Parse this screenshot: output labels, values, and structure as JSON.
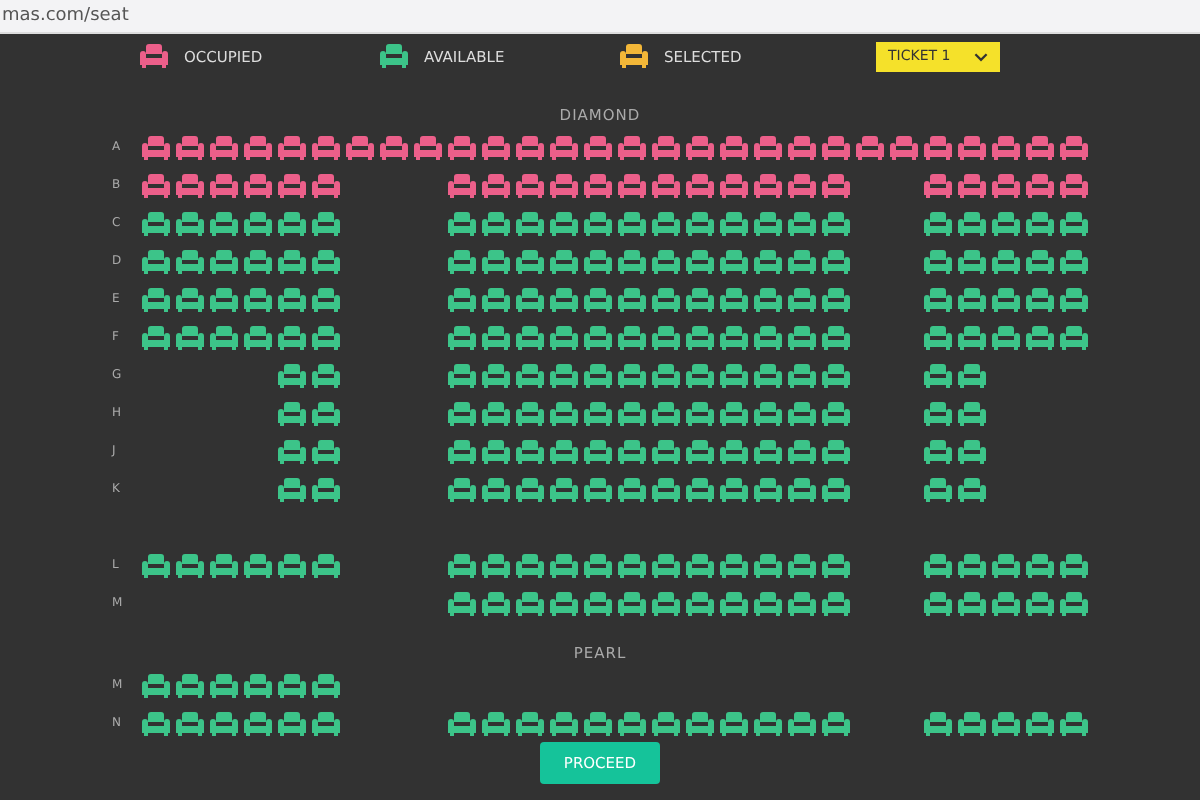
{
  "address_bar": {
    "url": "mas.com/seat"
  },
  "legend": [
    {
      "label": "OCCUPIED",
      "color": "#ec5f8a"
    },
    {
      "label": "AVAILABLE",
      "color": "#3cc489"
    },
    {
      "label": "SELECTED",
      "color": "#f3b738"
    }
  ],
  "ticket_select": {
    "value": "TICKET 1"
  },
  "sections": [
    {
      "title": "DIAMOND",
      "rows": [
        {
          "label": "A",
          "kind": "row",
          "seats": [
            {
              "kind": "seat",
              "occupied": true
            },
            {
              "kind": "seat",
              "occupied": true
            },
            {
              "kind": "seat",
              "occupied": true
            },
            {
              "kind": "seat",
              "occupied": true
            },
            {
              "kind": "seat",
              "occupied": true
            },
            {
              "kind": "seat",
              "occupied": true
            },
            {
              "kind": "seat",
              "occupied": true
            },
            {
              "kind": "seat",
              "occupied": true
            },
            {
              "kind": "seat",
              "occupied": true
            },
            {
              "kind": "seat",
              "occupied": true
            },
            {
              "kind": "seat",
              "occupied": true
            },
            {
              "kind": "seat",
              "occupied": true
            },
            {
              "kind": "seat",
              "occupied": true
            },
            {
              "kind": "seat",
              "occupied": true
            },
            {
              "kind": "seat",
              "occupied": true
            },
            {
              "kind": "seat",
              "occupied": true
            },
            {
              "kind": "seat",
              "occupied": true
            },
            {
              "kind": "seat",
              "occupied": true
            },
            {
              "kind": "seat",
              "occupied": true
            },
            {
              "kind": "seat",
              "occupied": true
            },
            {
              "kind": "seat",
              "occupied": true
            },
            {
              "kind": "seat",
              "occupied": true
            },
            {
              "kind": "seat",
              "occupied": true
            },
            {
              "kind": "seat",
              "occupied": true
            },
            {
              "kind": "seat",
              "occupied": true
            },
            {
              "kind": "seat",
              "occupied": true
            },
            {
              "kind": "seat",
              "occupied": true
            },
            {
              "kind": "seat",
              "occupied": true
            }
          ]
        },
        {
          "label": "B",
          "kind": "row",
          "seats": [
            {
              "kind": "seat",
              "occupied": true
            },
            {
              "kind": "seat",
              "occupied": true
            },
            {
              "kind": "seat",
              "occupied": true
            },
            {
              "kind": "seat",
              "occupied": true
            },
            {
              "kind": "seat",
              "occupied": true
            },
            {
              "kind": "seat",
              "occupied": true
            },
            {
              "kind": "aisle"
            },
            {
              "kind": "aisle"
            },
            {
              "kind": "aisle"
            },
            {
              "kind": "seat",
              "occupied": true
            },
            {
              "kind": "seat",
              "occupied": true
            },
            {
              "kind": "seat",
              "occupied": true
            },
            {
              "kind": "seat",
              "occupied": true
            },
            {
              "kind": "seat",
              "occupied": true
            },
            {
              "kind": "seat",
              "occupied": true
            },
            {
              "kind": "seat",
              "occupied": true
            },
            {
              "kind": "seat",
              "occupied": true
            },
            {
              "kind": "seat",
              "occupied": true
            },
            {
              "kind": "seat",
              "occupied": true
            },
            {
              "kind": "seat",
              "occupied": true
            },
            {
              "kind": "seat",
              "occupied": true
            },
            {
              "kind": "aisle"
            },
            {
              "kind": "aisle"
            },
            {
              "kind": "seat",
              "occupied": true
            },
            {
              "kind": "seat",
              "occupied": true
            },
            {
              "kind": "seat",
              "occupied": true
            },
            {
              "kind": "seat",
              "occupied": true
            },
            {
              "kind": "seat",
              "occupied": true
            }
          ]
        },
        {
          "label": "C",
          "kind": "row",
          "seats": [
            {
              "kind": "seat",
              "occupied": false
            },
            {
              "kind": "seat",
              "occupied": false
            },
            {
              "kind": "seat",
              "occupied": false
            },
            {
              "kind": "seat",
              "occupied": false
            },
            {
              "kind": "seat",
              "occupied": false
            },
            {
              "kind": "seat",
              "occupied": false
            },
            {
              "kind": "aisle"
            },
            {
              "kind": "aisle"
            },
            {
              "kind": "aisle"
            },
            {
              "kind": "seat",
              "occupied": false
            },
            {
              "kind": "seat",
              "occupied": false
            },
            {
              "kind": "seat",
              "occupied": false
            },
            {
              "kind": "seat",
              "occupied": false
            },
            {
              "kind": "seat",
              "occupied": false
            },
            {
              "kind": "seat",
              "occupied": false
            },
            {
              "kind": "seat",
              "occupied": false
            },
            {
              "kind": "seat",
              "occupied": false
            },
            {
              "kind": "seat",
              "occupied": false
            },
            {
              "kind": "seat",
              "occupied": false
            },
            {
              "kind": "seat",
              "occupied": false
            },
            {
              "kind": "seat",
              "occupied": false
            },
            {
              "kind": "aisle"
            },
            {
              "kind": "aisle"
            },
            {
              "kind": "seat",
              "occupied": false
            },
            {
              "kind": "seat",
              "occupied": false
            },
            {
              "kind": "seat",
              "occupied": false
            },
            {
              "kind": "seat",
              "occupied": false
            },
            {
              "kind": "seat",
              "occupied": false
            }
          ]
        },
        {
          "label": "D",
          "kind": "row",
          "seats": [
            {
              "kind": "seat",
              "occupied": false
            },
            {
              "kind": "seat",
              "occupied": false
            },
            {
              "kind": "seat",
              "occupied": false
            },
            {
              "kind": "seat",
              "occupied": false
            },
            {
              "kind": "seat",
              "occupied": false
            },
            {
              "kind": "seat",
              "occupied": false
            },
            {
              "kind": "aisle"
            },
            {
              "kind": "aisle"
            },
            {
              "kind": "aisle"
            },
            {
              "kind": "seat",
              "occupied": false
            },
            {
              "kind": "seat",
              "occupied": false
            },
            {
              "kind": "seat",
              "occupied": false
            },
            {
              "kind": "seat",
              "occupied": false
            },
            {
              "kind": "seat",
              "occupied": false
            },
            {
              "kind": "seat",
              "occupied": false
            },
            {
              "kind": "seat",
              "occupied": false
            },
            {
              "kind": "seat",
              "occupied": false
            },
            {
              "kind": "seat",
              "occupied": false
            },
            {
              "kind": "seat",
              "occupied": false
            },
            {
              "kind": "seat",
              "occupied": false
            },
            {
              "kind": "seat",
              "occupied": false
            },
            {
              "kind": "aisle"
            },
            {
              "kind": "aisle"
            },
            {
              "kind": "seat",
              "occupied": false
            },
            {
              "kind": "seat",
              "occupied": false
            },
            {
              "kind": "seat",
              "occupied": false
            },
            {
              "kind": "seat",
              "occupied": false
            },
            {
              "kind": "seat",
              "occupied": false
            }
          ]
        },
        {
          "label": "E",
          "kind": "row",
          "seats": [
            {
              "kind": "seat",
              "occupied": false
            },
            {
              "kind": "seat",
              "occupied": false
            },
            {
              "kind": "seat",
              "occupied": false
            },
            {
              "kind": "seat",
              "occupied": false
            },
            {
              "kind": "seat",
              "occupied": false
            },
            {
              "kind": "seat",
              "occupied": false
            },
            {
              "kind": "aisle"
            },
            {
              "kind": "aisle"
            },
            {
              "kind": "aisle"
            },
            {
              "kind": "seat",
              "occupied": false
            },
            {
              "kind": "seat",
              "occupied": false
            },
            {
              "kind": "seat",
              "occupied": false
            },
            {
              "kind": "seat",
              "occupied": false
            },
            {
              "kind": "seat",
              "occupied": false
            },
            {
              "kind": "seat",
              "occupied": false
            },
            {
              "kind": "seat",
              "occupied": false
            },
            {
              "kind": "seat",
              "occupied": false
            },
            {
              "kind": "seat",
              "occupied": false
            },
            {
              "kind": "seat",
              "occupied": false
            },
            {
              "kind": "seat",
              "occupied": false
            },
            {
              "kind": "seat",
              "occupied": false
            },
            {
              "kind": "aisle"
            },
            {
              "kind": "aisle"
            },
            {
              "kind": "seat",
              "occupied": false
            },
            {
              "kind": "seat",
              "occupied": false
            },
            {
              "kind": "seat",
              "occupied": false
            },
            {
              "kind": "seat",
              "occupied": false
            },
            {
              "kind": "seat",
              "occupied": false
            }
          ]
        },
        {
          "label": "F",
          "kind": "row",
          "seats": [
            {
              "kind": "seat",
              "occupied": false
            },
            {
              "kind": "seat",
              "occupied": false
            },
            {
              "kind": "seat",
              "occupied": false
            },
            {
              "kind": "seat",
              "occupied": false
            },
            {
              "kind": "seat",
              "occupied": false
            },
            {
              "kind": "seat",
              "occupied": false
            },
            {
              "kind": "aisle"
            },
            {
              "kind": "aisle"
            },
            {
              "kind": "aisle"
            },
            {
              "kind": "seat",
              "occupied": false
            },
            {
              "kind": "seat",
              "occupied": false
            },
            {
              "kind": "seat",
              "occupied": false
            },
            {
              "kind": "seat",
              "occupied": false
            },
            {
              "kind": "seat",
              "occupied": false
            },
            {
              "kind": "seat",
              "occupied": false
            },
            {
              "kind": "seat",
              "occupied": false
            },
            {
              "kind": "seat",
              "occupied": false
            },
            {
              "kind": "seat",
              "occupied": false
            },
            {
              "kind": "seat",
              "occupied": false
            },
            {
              "kind": "seat",
              "occupied": false
            },
            {
              "kind": "seat",
              "occupied": false
            },
            {
              "kind": "aisle"
            },
            {
              "kind": "aisle"
            },
            {
              "kind": "seat",
              "occupied": false
            },
            {
              "kind": "seat",
              "occupied": false
            },
            {
              "kind": "seat",
              "occupied": false
            },
            {
              "kind": "seat",
              "occupied": false
            },
            {
              "kind": "seat",
              "occupied": false
            }
          ]
        },
        {
          "label": "G",
          "kind": "row",
          "seats": [
            {
              "kind": "aisle"
            },
            {
              "kind": "aisle"
            },
            {
              "kind": "aisle"
            },
            {
              "kind": "aisle"
            },
            {
              "kind": "seat",
              "occupied": false
            },
            {
              "kind": "seat",
              "occupied": false
            },
            {
              "kind": "aisle"
            },
            {
              "kind": "aisle"
            },
            {
              "kind": "aisle"
            },
            {
              "kind": "seat",
              "occupied": false
            },
            {
              "kind": "seat",
              "occupied": false
            },
            {
              "kind": "seat",
              "occupied": false
            },
            {
              "kind": "seat",
              "occupied": false
            },
            {
              "kind": "seat",
              "occupied": false
            },
            {
              "kind": "seat",
              "occupied": false
            },
            {
              "kind": "seat",
              "occupied": false
            },
            {
              "kind": "seat",
              "occupied": false
            },
            {
              "kind": "seat",
              "occupied": false
            },
            {
              "kind": "seat",
              "occupied": false
            },
            {
              "kind": "seat",
              "occupied": false
            },
            {
              "kind": "seat",
              "occupied": false
            },
            {
              "kind": "aisle"
            },
            {
              "kind": "aisle"
            },
            {
              "kind": "seat",
              "occupied": false
            },
            {
              "kind": "seat",
              "occupied": false
            }
          ]
        },
        {
          "label": "H",
          "kind": "row",
          "seats": [
            {
              "kind": "aisle"
            },
            {
              "kind": "aisle"
            },
            {
              "kind": "aisle"
            },
            {
              "kind": "aisle"
            },
            {
              "kind": "seat",
              "occupied": false
            },
            {
              "kind": "seat",
              "occupied": false
            },
            {
              "kind": "aisle"
            },
            {
              "kind": "aisle"
            },
            {
              "kind": "aisle"
            },
            {
              "kind": "seat",
              "occupied": false
            },
            {
              "kind": "seat",
              "occupied": false
            },
            {
              "kind": "seat",
              "occupied": false
            },
            {
              "kind": "seat",
              "occupied": false
            },
            {
              "kind": "seat",
              "occupied": false
            },
            {
              "kind": "seat",
              "occupied": false
            },
            {
              "kind": "seat",
              "occupied": false
            },
            {
              "kind": "seat",
              "occupied": false
            },
            {
              "kind": "seat",
              "occupied": false
            },
            {
              "kind": "seat",
              "occupied": false
            },
            {
              "kind": "seat",
              "occupied": false
            },
            {
              "kind": "seat",
              "occupied": false
            },
            {
              "kind": "aisle"
            },
            {
              "kind": "aisle"
            },
            {
              "kind": "seat",
              "occupied": false
            },
            {
              "kind": "seat",
              "occupied": false
            }
          ]
        },
        {
          "label": "J",
          "kind": "row",
          "seats": [
            {
              "kind": "aisle"
            },
            {
              "kind": "aisle"
            },
            {
              "kind": "aisle"
            },
            {
              "kind": "aisle"
            },
            {
              "kind": "seat",
              "occupied": false
            },
            {
              "kind": "seat",
              "occupied": false
            },
            {
              "kind": "aisle"
            },
            {
              "kind": "aisle"
            },
            {
              "kind": "aisle"
            },
            {
              "kind": "seat",
              "occupied": false
            },
            {
              "kind": "seat",
              "occupied": false
            },
            {
              "kind": "seat",
              "occupied": false
            },
            {
              "kind": "seat",
              "occupied": false
            },
            {
              "kind": "seat",
              "occupied": false
            },
            {
              "kind": "seat",
              "occupied": false
            },
            {
              "kind": "seat",
              "occupied": false
            },
            {
              "kind": "seat",
              "occupied": false
            },
            {
              "kind": "seat",
              "occupied": false
            },
            {
              "kind": "seat",
              "occupied": false
            },
            {
              "kind": "seat",
              "occupied": false
            },
            {
              "kind": "seat",
              "occupied": false
            },
            {
              "kind": "aisle"
            },
            {
              "kind": "aisle"
            },
            {
              "kind": "seat",
              "occupied": false
            },
            {
              "kind": "seat",
              "occupied": false
            }
          ]
        },
        {
          "label": "K",
          "kind": "row",
          "seats": [
            {
              "kind": "aisle"
            },
            {
              "kind": "aisle"
            },
            {
              "kind": "aisle"
            },
            {
              "kind": "aisle"
            },
            {
              "kind": "seat",
              "occupied": false
            },
            {
              "kind": "seat",
              "occupied": false
            },
            {
              "kind": "aisle"
            },
            {
              "kind": "aisle"
            },
            {
              "kind": "aisle"
            },
            {
              "kind": "seat",
              "occupied": false
            },
            {
              "kind": "seat",
              "occupied": false
            },
            {
              "kind": "seat",
              "occupied": false
            },
            {
              "kind": "seat",
              "occupied": false
            },
            {
              "kind": "seat",
              "occupied": false
            },
            {
              "kind": "seat",
              "occupied": false
            },
            {
              "kind": "seat",
              "occupied": false
            },
            {
              "kind": "seat",
              "occupied": false
            },
            {
              "kind": "seat",
              "occupied": false
            },
            {
              "kind": "seat",
              "occupied": false
            },
            {
              "kind": "seat",
              "occupied": false
            },
            {
              "kind": "seat",
              "occupied": false
            },
            {
              "kind": "aisle"
            },
            {
              "kind": "aisle"
            },
            {
              "kind": "seat",
              "occupied": false
            },
            {
              "kind": "seat",
              "occupied": false
            }
          ]
        },
        {
          "kind": "spacer"
        },
        {
          "label": "L",
          "kind": "row",
          "seats": [
            {
              "kind": "seat",
              "occupied": false
            },
            {
              "kind": "seat",
              "occupied": false
            },
            {
              "kind": "seat",
              "occupied": false
            },
            {
              "kind": "seat",
              "occupied": false
            },
            {
              "kind": "seat",
              "occupied": false
            },
            {
              "kind": "seat",
              "occupied": false
            },
            {
              "kind": "aisle"
            },
            {
              "kind": "aisle"
            },
            {
              "kind": "aisle"
            },
            {
              "kind": "seat",
              "occupied": false
            },
            {
              "kind": "seat",
              "occupied": false
            },
            {
              "kind": "seat",
              "occupied": false
            },
            {
              "kind": "seat",
              "occupied": false
            },
            {
              "kind": "seat",
              "occupied": false
            },
            {
              "kind": "seat",
              "occupied": false
            },
            {
              "kind": "seat",
              "occupied": false
            },
            {
              "kind": "seat",
              "occupied": false
            },
            {
              "kind": "seat",
              "occupied": false
            },
            {
              "kind": "seat",
              "occupied": false
            },
            {
              "kind": "seat",
              "occupied": false
            },
            {
              "kind": "seat",
              "occupied": false
            },
            {
              "kind": "aisle"
            },
            {
              "kind": "aisle"
            },
            {
              "kind": "seat",
              "occupied": false
            },
            {
              "kind": "seat",
              "occupied": false
            },
            {
              "kind": "seat",
              "occupied": false
            },
            {
              "kind": "seat",
              "occupied": false
            },
            {
              "kind": "seat",
              "occupied": false
            }
          ]
        },
        {
          "label": "M",
          "kind": "row",
          "seats": [
            {
              "kind": "aisle"
            },
            {
              "kind": "aisle"
            },
            {
              "kind": "aisle"
            },
            {
              "kind": "aisle"
            },
            {
              "kind": "aisle"
            },
            {
              "kind": "aisle"
            },
            {
              "kind": "aisle"
            },
            {
              "kind": "aisle"
            },
            {
              "kind": "aisle"
            },
            {
              "kind": "seat",
              "occupied": false
            },
            {
              "kind": "seat",
              "occupied": false
            },
            {
              "kind": "seat",
              "occupied": false
            },
            {
              "kind": "seat",
              "occupied": false
            },
            {
              "kind": "seat",
              "occupied": false
            },
            {
              "kind": "seat",
              "occupied": false
            },
            {
              "kind": "seat",
              "occupied": false
            },
            {
              "kind": "seat",
              "occupied": false
            },
            {
              "kind": "seat",
              "occupied": false
            },
            {
              "kind": "seat",
              "occupied": false
            },
            {
              "kind": "seat",
              "occupied": false
            },
            {
              "kind": "seat",
              "occupied": false
            },
            {
              "kind": "aisle"
            },
            {
              "kind": "aisle"
            },
            {
              "kind": "seat",
              "occupied": false
            },
            {
              "kind": "seat",
              "occupied": false
            },
            {
              "kind": "seat",
              "occupied": false
            },
            {
              "kind": "seat",
              "occupied": false
            },
            {
              "kind": "seat",
              "occupied": false
            }
          ]
        }
      ]
    },
    {
      "title": "PEARL",
      "rows": [
        {
          "label": "M",
          "kind": "row",
          "seats": [
            {
              "kind": "seat",
              "occupied": false
            },
            {
              "kind": "seat",
              "occupied": false
            },
            {
              "kind": "seat",
              "occupied": false
            },
            {
              "kind": "seat",
              "occupied": false
            },
            {
              "kind": "seat",
              "occupied": false
            },
            {
              "kind": "seat",
              "occupied": false
            }
          ]
        },
        {
          "label": "N",
          "kind": "row",
          "seats": [
            {
              "kind": "seat",
              "occupied": false
            },
            {
              "kind": "seat",
              "occupied": false
            },
            {
              "kind": "seat",
              "occupied": false
            },
            {
              "kind": "seat",
              "occupied": false
            },
            {
              "kind": "seat",
              "occupied": false
            },
            {
              "kind": "seat",
              "occupied": false
            },
            {
              "kind": "aisle"
            },
            {
              "kind": "aisle"
            },
            {
              "kind": "aisle"
            },
            {
              "kind": "seat",
              "occupied": false
            },
            {
              "kind": "seat",
              "occupied": false
            },
            {
              "kind": "seat",
              "occupied": false
            },
            {
              "kind": "seat",
              "occupied": false
            },
            {
              "kind": "seat",
              "occupied": false
            },
            {
              "kind": "seat",
              "occupied": false
            },
            {
              "kind": "seat",
              "occupied": false
            },
            {
              "kind": "seat",
              "occupied": false
            },
            {
              "kind": "seat",
              "occupied": false
            },
            {
              "kind": "seat",
              "occupied": false
            },
            {
              "kind": "seat",
              "occupied": false
            },
            {
              "kind": "seat",
              "occupied": false
            },
            {
              "kind": "aisle"
            },
            {
              "kind": "aisle"
            },
            {
              "kind": "seat",
              "occupied": false
            },
            {
              "kind": "seat",
              "occupied": false
            },
            {
              "kind": "seat",
              "occupied": false
            },
            {
              "kind": "seat",
              "occupied": false
            },
            {
              "kind": "seat",
              "occupied": false
            }
          ]
        }
      ]
    }
  ],
  "proceed_button": {
    "label": "PROCEED"
  }
}
